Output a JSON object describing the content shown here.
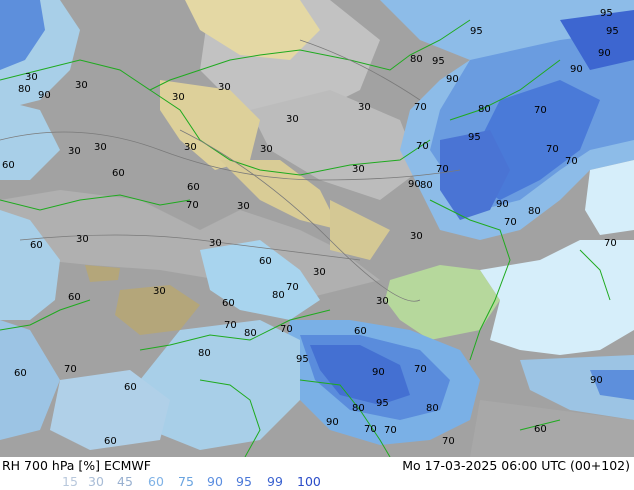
{
  "footer": {
    "title": "RH 700 hPa [%] ECMWF",
    "date": "Mo 17-03-2025 06:00 UTC (00+102)"
  },
  "legend": [
    {
      "label": "15",
      "color": "#b8c8dc"
    },
    {
      "label": "30",
      "color": "#a8bcd6"
    },
    {
      "label": "45",
      "color": "#98b0d0"
    },
    {
      "label": "60",
      "color": "#7fb2e6"
    },
    {
      "label": "75",
      "color": "#6aa4e0"
    },
    {
      "label": "90",
      "color": "#5b8ee0"
    },
    {
      "label": "95",
      "color": "#4a78d8"
    },
    {
      "label": "99",
      "color": "#3a62d0"
    },
    {
      "label": "100",
      "color": "#2a4cc8"
    }
  ],
  "colors": {
    "dry_land": "#e8dca8",
    "very_dry": "#b8a878",
    "mid": "#9a9a9a",
    "light_gray": "#c4c4c4",
    "humid_light": "#a8d8f0",
    "humid_mid": "#7cb0e8",
    "humid_high": "#4a78d8",
    "sea": "#d6eefa",
    "border": "#22aa22",
    "lowland": "#b6d89c"
  },
  "contour_labels": [
    "30",
    "30",
    "30",
    "30",
    "30",
    "30",
    "30",
    "30",
    "30",
    "30",
    "30",
    "30",
    "30",
    "30",
    "30",
    "30",
    "30",
    "30",
    "60",
    "60",
    "60",
    "60",
    "60",
    "60",
    "60",
    "60",
    "60",
    "60",
    "60",
    "60",
    "70",
    "70",
    "70",
    "70",
    "70",
    "70",
    "70",
    "70",
    "70",
    "70",
    "70",
    "70",
    "70",
    "70",
    "70",
    "70",
    "70",
    "80",
    "80",
    "80",
    "80",
    "80",
    "80",
    "80",
    "80",
    "80",
    "80",
    "90",
    "90",
    "90",
    "90",
    "90",
    "90",
    "90",
    "90",
    "90",
    "95",
    "95",
    "95",
    "95",
    "95",
    "95",
    "95"
  ]
}
